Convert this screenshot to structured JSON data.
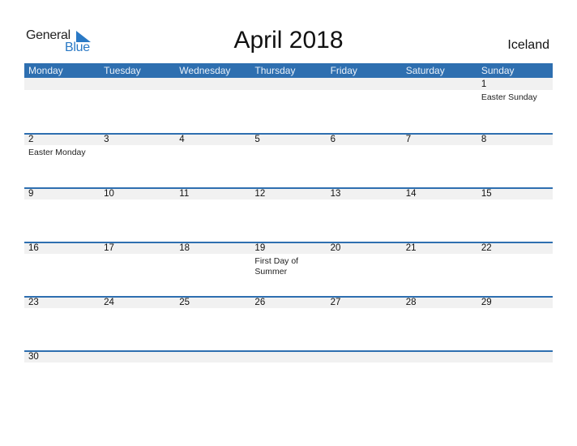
{
  "logo": {
    "word1": "General",
    "word2": "Blue"
  },
  "title": "April 2018",
  "country": "Iceland",
  "colors": {
    "header_bg": "#2e6fb0",
    "band_bg": "#f1f1f1",
    "logo_blue": "#2a79c5"
  },
  "weekdays": [
    "Monday",
    "Tuesday",
    "Wednesday",
    "Thursday",
    "Friday",
    "Saturday",
    "Sunday"
  ],
  "weeks": [
    [
      {
        "day": ""
      },
      {
        "day": ""
      },
      {
        "day": ""
      },
      {
        "day": ""
      },
      {
        "day": ""
      },
      {
        "day": ""
      },
      {
        "day": "1",
        "event": "Easter Sunday"
      }
    ],
    [
      {
        "day": "2",
        "event": "Easter Monday"
      },
      {
        "day": "3"
      },
      {
        "day": "4"
      },
      {
        "day": "5"
      },
      {
        "day": "6"
      },
      {
        "day": "7"
      },
      {
        "day": "8"
      }
    ],
    [
      {
        "day": "9"
      },
      {
        "day": "10"
      },
      {
        "day": "11"
      },
      {
        "day": "12"
      },
      {
        "day": "13"
      },
      {
        "day": "14"
      },
      {
        "day": "15"
      }
    ],
    [
      {
        "day": "16"
      },
      {
        "day": "17"
      },
      {
        "day": "18"
      },
      {
        "day": "19",
        "event": "First Day of Summer"
      },
      {
        "day": "20"
      },
      {
        "day": "21"
      },
      {
        "day": "22"
      }
    ],
    [
      {
        "day": "23"
      },
      {
        "day": "24"
      },
      {
        "day": "25"
      },
      {
        "day": "26"
      },
      {
        "day": "27"
      },
      {
        "day": "28"
      },
      {
        "day": "29"
      }
    ],
    [
      {
        "day": "30"
      },
      {
        "day": ""
      },
      {
        "day": ""
      },
      {
        "day": ""
      },
      {
        "day": ""
      },
      {
        "day": ""
      },
      {
        "day": ""
      }
    ]
  ]
}
